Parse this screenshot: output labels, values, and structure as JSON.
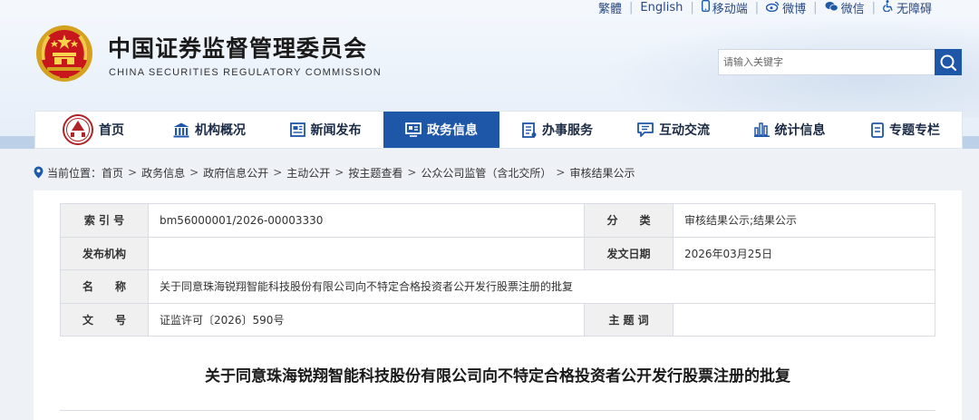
{
  "header": {
    "title": "中国证券监督管理委员会",
    "subtitle": "CHINA SECURITIES REGULATORY COMMISSION",
    "top_links": {
      "traditional": "繁體",
      "english": "English",
      "mobile": "移动端",
      "weibo": "微博",
      "wechat": "微信",
      "accessibility": "无障碍"
    },
    "search_placeholder": "请输入关键字"
  },
  "nav": {
    "items": [
      {
        "label": "首页",
        "icon": "emblem-icon"
      },
      {
        "label": "机构概况",
        "icon": "building-icon"
      },
      {
        "label": "新闻发布",
        "icon": "news-icon"
      },
      {
        "label": "政务信息",
        "icon": "monitor-icon",
        "active": true
      },
      {
        "label": "办事服务",
        "icon": "form-icon"
      },
      {
        "label": "互动交流",
        "icon": "chat-icon"
      },
      {
        "label": "统计信息",
        "icon": "bar-chart-icon"
      },
      {
        "label": "专题专栏",
        "icon": "document-icon"
      }
    ]
  },
  "breadcrumb": {
    "prefix": "当前位置：",
    "items": [
      "首页",
      "政务信息",
      "政府信息公开",
      "主动公开",
      "按主题查看",
      "公众公司监管（含北交所）",
      "审核结果公示"
    ]
  },
  "meta": {
    "index_label": "索 引 号",
    "index_value": "bm56000001/2026-00003330",
    "category_label": "分　　类",
    "category_value": "审核结果公示;结果公示",
    "issuer_label": "发布机构",
    "issuer_value": "",
    "date_label": "发文日期",
    "date_value": "2026年03月25日",
    "name_label": "名　　称",
    "name_value": "关于同意珠海锐翔智能科技股份有限公司向不特定合格投资者公开发行股票注册的批复",
    "docno_label": "文　　号",
    "docno_value": "证监许可〔2026〕590号",
    "keywords_label": "主 题 词",
    "keywords_value": ""
  },
  "document": {
    "title": "关于同意珠海锐翔智能科技股份有限公司向不特定合格投资者公开发行股票注册的批复"
  },
  "colors": {
    "brand": "#1e56a8",
    "header_bg": "#e9f0f9",
    "label_bg": "#f0f0f0"
  }
}
